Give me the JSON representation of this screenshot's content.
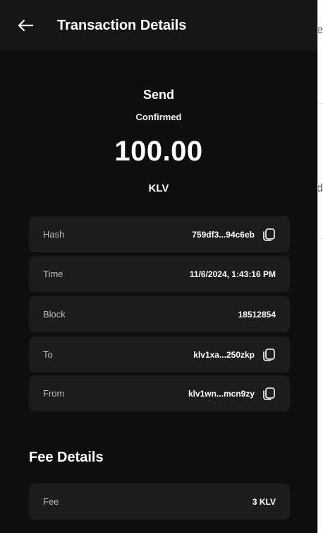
{
  "backdrop": {
    "text_1": "e",
    "text_2": "d"
  },
  "header": {
    "back_icon": "arrow-left-icon",
    "title": "Transaction Details"
  },
  "summary": {
    "type": "Send",
    "status": "Confirmed",
    "amount": "100.00",
    "token": "KLV"
  },
  "details": [
    {
      "label": "Hash",
      "value": "759df3...94c6eb",
      "copyable": true,
      "icon": "copy-icon"
    },
    {
      "label": "Time",
      "value": "11/6/2024, 1:43:16 PM",
      "copyable": false
    },
    {
      "label": "Block",
      "value": "18512854",
      "copyable": false
    },
    {
      "label": "To",
      "value": "klv1xa...250zkp",
      "copyable": true,
      "icon": "copy-icon"
    },
    {
      "label": "From",
      "value": "klv1wn...mcn9zy",
      "copyable": true,
      "icon": "copy-icon"
    }
  ],
  "fee_details": {
    "title": "Fee Details",
    "rows": [
      {
        "label": "Fee",
        "value": "3 KLV"
      }
    ]
  },
  "colors": {
    "panel_bg": "#0e0e0e",
    "header_bg": "#161616",
    "row_bg": "#1c1c1c",
    "text": "#ffffff",
    "muted_text": "#bdbdbd"
  }
}
